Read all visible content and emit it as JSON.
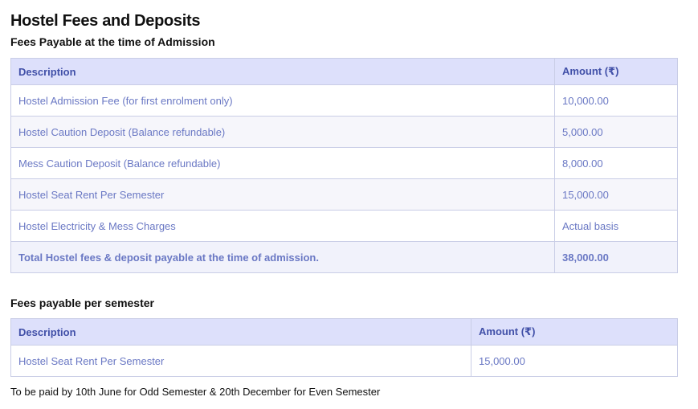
{
  "page": {
    "title": "Hostel Fees and Deposits"
  },
  "admission": {
    "heading": "Fees Payable at the time of Admission",
    "columns": {
      "description": "Description",
      "amount": "Amount (₹)"
    },
    "rows": [
      {
        "description": "Hostel Admission Fee (for first enrolment only)",
        "amount": "10,000.00"
      },
      {
        "description": "Hostel Caution Deposit (Balance refundable)",
        "amount": "5,000.00"
      },
      {
        "description": "Mess Caution Deposit (Balance refundable)",
        "amount": "8,000.00"
      },
      {
        "description": "Hostel Seat Rent Per Semester",
        "amount": "15,000.00"
      },
      {
        "description": "Hostel Electricity & Mess Charges",
        "amount": "Actual basis"
      }
    ],
    "total": {
      "description": "Total Hostel fees & deposit payable at the time of admission.",
      "amount": "38,000.00"
    }
  },
  "semester": {
    "heading": "Fees payable per semester",
    "columns": {
      "description": "Description",
      "amount": "Amount (₹)"
    },
    "rows": [
      {
        "description": "Hostel Seat Rent Per Semester",
        "amount": "15,000.00"
      }
    ],
    "note": "To be paid by 10th June for Odd Semester & 20th December for Even Semester"
  }
}
